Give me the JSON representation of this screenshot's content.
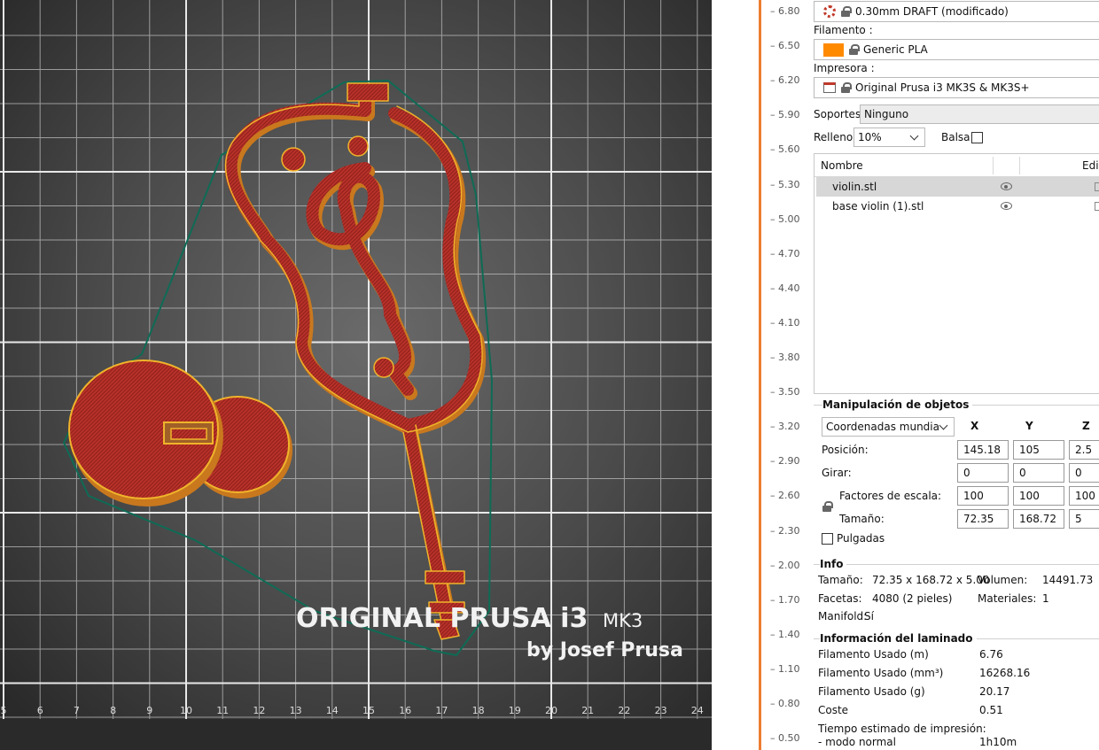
{
  "viewport": {
    "brand_line1": "ORIGINAL PRUSA i3",
    "brand_model": "MK3",
    "brand_line2": "by Josef Prusa",
    "axis_numbers": [
      "5",
      "6",
      "7",
      "8",
      "9",
      "10",
      "11",
      "12",
      "13",
      "14",
      "15",
      "16",
      "17",
      "18",
      "19",
      "20",
      "21",
      "22",
      "23",
      "24"
    ]
  },
  "layer_slider": {
    "ticks": [
      "6.80",
      "6.50",
      "6.20",
      "5.90",
      "5.60",
      "5.30",
      "5.00",
      "4.70",
      "4.40",
      "4.10",
      "3.80",
      "3.50",
      "3.20",
      "2.90",
      "2.60",
      "2.30",
      "2.00",
      "1.70",
      "1.40",
      "1.10",
      "0.80",
      "0.50"
    ],
    "accent_color": "#ed7d31"
  },
  "settings": {
    "print_profile": "0.30mm DRAFT (modificado)",
    "filament_label": "Filamento :",
    "filament_value": "Generic PLA",
    "filament_color": "#ff8a00",
    "printer_label": "Impresora :",
    "printer_value": "Original Prusa i3 MK3S & MK3S+",
    "supports_label": "Soportes:",
    "supports_value": "Ninguno",
    "infill_label": "Relleno:",
    "infill_value": "10%",
    "raft_label": "Balsa:"
  },
  "object_list": {
    "col_name": "Nombre",
    "col_edit": "Edic",
    "items": [
      {
        "name": "violin.stl",
        "selected": true
      },
      {
        "name": "base violin (1).stl",
        "selected": false
      }
    ]
  },
  "manipulation": {
    "title": "Manipulación de objetos",
    "coord_select": "Coordenadas mundiales",
    "axis_x": "X",
    "axis_y": "Y",
    "axis_z": "Z",
    "position_label": "Posición:",
    "position": [
      "145.18",
      "105",
      "2.5"
    ],
    "rotate_label": "Girar:",
    "rotate": [
      "0",
      "0",
      "0"
    ],
    "scale_label": "Factores de escala:",
    "scale": [
      "100",
      "100",
      "100"
    ],
    "size_label": "Tamaño:",
    "size": [
      "72.35",
      "168.72",
      "5"
    ],
    "inches_label": "Pulgadas"
  },
  "info": {
    "title": "Info",
    "size_label": "Tamaño:",
    "size_value": "72.35 x 168.72 x 5.00",
    "volume_label": "Volumen:",
    "volume_value": "14491.73",
    "facets_label": "Facetas:",
    "facets_value": "4080 (2 pieles)",
    "materials_label": "Materiales:",
    "materials_value": "1",
    "manifold_label": "Manifold:",
    "manifold_value": "Sí"
  },
  "slicing": {
    "title": "Información del laminado",
    "rows": [
      {
        "label": "Filamento Usado (m)",
        "value": "6.76"
      },
      {
        "label": "Filamento Usado (mm³)",
        "value": "16268.16"
      },
      {
        "label": "Filamento Usado (g)",
        "value": "20.17"
      },
      {
        "label": "Coste",
        "value": "0.51"
      }
    ],
    "time_label": "Tiempo estimado de impresión:",
    "mode_label": "- modo normal",
    "mode_value": "1h10m"
  }
}
